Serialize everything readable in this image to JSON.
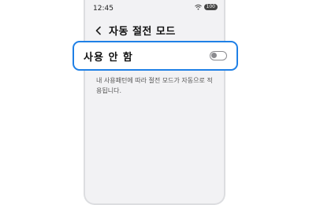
{
  "status_bar": {
    "time": "12:45",
    "wifi_icon": "wifi-icon",
    "battery_level": "100"
  },
  "header": {
    "back_icon": "chevron-left-icon",
    "title": "자동 절전 모드"
  },
  "setting": {
    "label": "사용 안 함",
    "enabled": false,
    "description": "내 사용패턴에 따라 절전 모드가 자동으로 적용됩니다."
  },
  "colors": {
    "highlight_border": "#1f80e6",
    "toggle_off": "#8b8b8f",
    "screen_background": "#f2f2f4"
  }
}
